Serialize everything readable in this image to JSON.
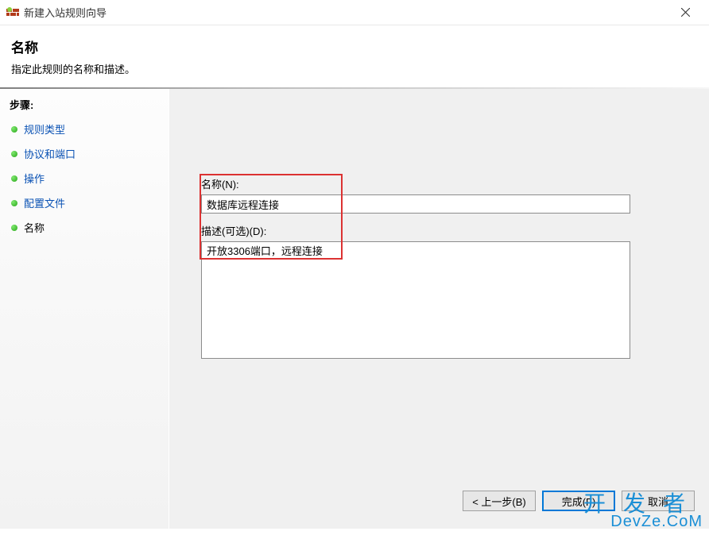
{
  "window": {
    "title": "新建入站规则向导"
  },
  "header": {
    "title": "名称",
    "subtitle": "指定此规则的名称和描述。"
  },
  "sidebar": {
    "steps_label": "步骤:",
    "items": [
      {
        "label": "规则类型",
        "current": false
      },
      {
        "label": "协议和端口",
        "current": false
      },
      {
        "label": "操作",
        "current": false
      },
      {
        "label": "配置文件",
        "current": false
      },
      {
        "label": "名称",
        "current": true
      }
    ]
  },
  "form": {
    "name_label": "名称(N):",
    "name_value": "数据库远程连接",
    "desc_label": "描述(可选)(D):",
    "desc_value": "开放3306端口，远程连接"
  },
  "buttons": {
    "back": "< 上一步(B)",
    "finish": "完成(F)",
    "cancel": "取消"
  },
  "watermark": {
    "line1": "开发者",
    "line2": "DevZe.CoM"
  }
}
